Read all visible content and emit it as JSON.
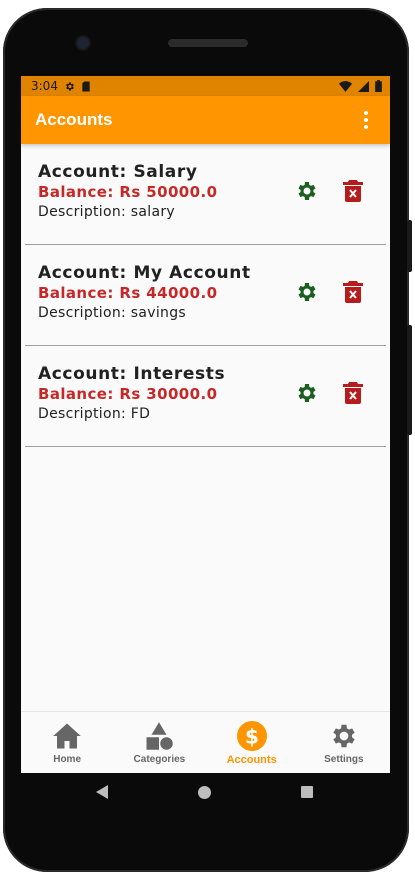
{
  "status_bar": {
    "time": "3:04"
  },
  "app_bar": {
    "title": "Accounts"
  },
  "accounts": [
    {
      "name": "Account: Salary",
      "balance": "Balance: Rs 50000.0",
      "description": "Description: salary"
    },
    {
      "name": "Account: My Account",
      "balance": "Balance: Rs 44000.0",
      "description": "Description: savings"
    },
    {
      "name": "Account: Interests",
      "balance": "Balance: Rs 30000.0",
      "description": "Description: FD"
    }
  ],
  "bottom_nav": [
    {
      "label": "Home",
      "icon": "home-icon",
      "active": false
    },
    {
      "label": "Categories",
      "icon": "categories-icon",
      "active": false
    },
    {
      "label": "Accounts",
      "icon": "dollar-icon",
      "active": true
    },
    {
      "label": "Settings",
      "icon": "gear-icon",
      "active": false
    }
  ],
  "colors": {
    "accent": "#ff9500",
    "status_bar": "#e08400",
    "balance": "#c62828",
    "edit_icon": "#1b5e20",
    "delete_icon": "#b71c1c",
    "nav_inactive": "#666666"
  }
}
